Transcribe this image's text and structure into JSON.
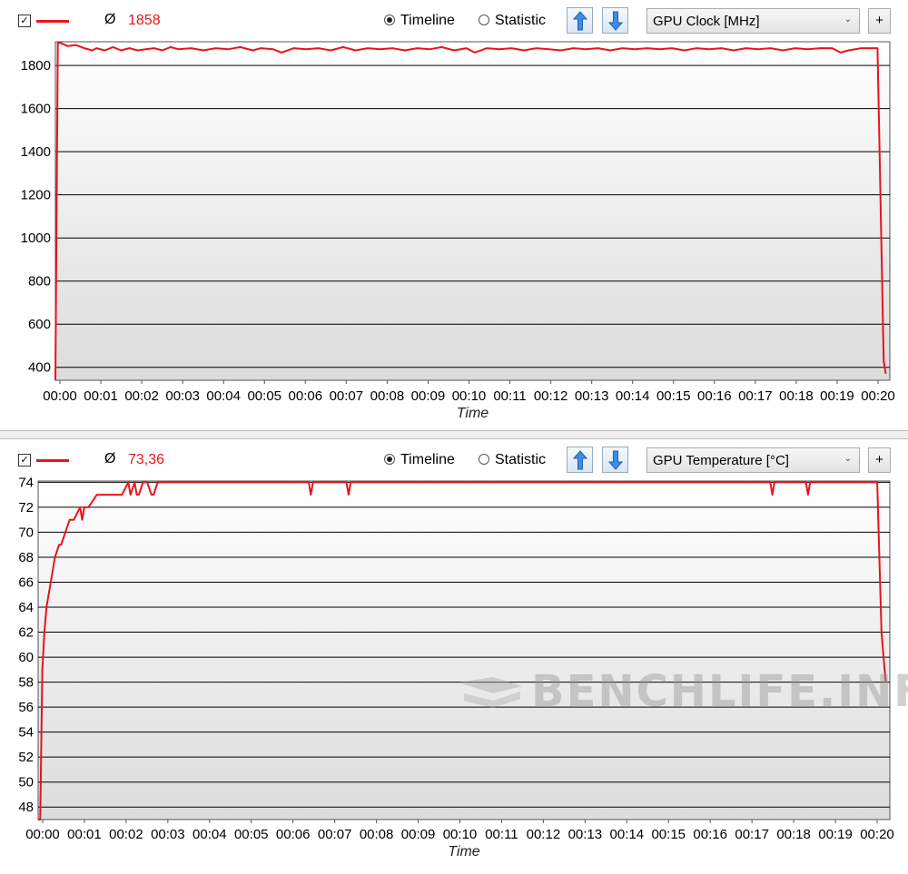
{
  "panels": [
    {
      "checkbox_checked": true,
      "avg_symbol": "Ø",
      "avg_value": "1858",
      "timeline_label": "Timeline",
      "statistic_label": "Statistic",
      "selected_view": "Timeline",
      "sensor_select": "GPU Clock [MHz]",
      "plus_label": "+",
      "line_color": "#e8141c"
    },
    {
      "checkbox_checked": true,
      "avg_symbol": "Ø",
      "avg_value": "73,36",
      "timeline_label": "Timeline",
      "statistic_label": "Statistic",
      "selected_view": "Timeline",
      "sensor_select": "GPU Temperature [°C]",
      "plus_label": "+",
      "line_color": "#e8141c"
    }
  ],
  "watermark": "BENCHLIFE.INFO",
  "chart_data": [
    {
      "type": "line",
      "xlabel": "Time",
      "ylabel": "",
      "x_ticks": [
        "00:00",
        "00:01",
        "00:02",
        "00:03",
        "00:04",
        "00:05",
        "00:06",
        "00:07",
        "00:08",
        "00:09",
        "00:10",
        "00:11",
        "00:12",
        "00:13",
        "00:14",
        "00:15",
        "00:16",
        "00:17",
        "00:18",
        "00:19",
        "00:20"
      ],
      "y_ticks": [
        400,
        600,
        800,
        1000,
        1200,
        1400,
        1600,
        1800
      ],
      "ylim": [
        340,
        1910
      ],
      "xlim_minutes": [
        0,
        20.3
      ],
      "grid": true,
      "series": [
        {
          "x_minutes": [
            0,
            0.06,
            0.12,
            0.3,
            0.5,
            0.7,
            0.9,
            1.0,
            1.2,
            1.4,
            1.6,
            1.8,
            2.0,
            2.2,
            2.4,
            2.6,
            2.8,
            3.0,
            3.3,
            3.6,
            3.9,
            4.2,
            4.5,
            4.8,
            5.0,
            5.3,
            5.5,
            5.8,
            6.1,
            6.4,
            6.7,
            7.0,
            7.3,
            7.6,
            7.9,
            8.2,
            8.5,
            8.8,
            9.1,
            9.4,
            9.7,
            10.0,
            10.2,
            10.5,
            10.8,
            11.1,
            11.4,
            11.7,
            12.0,
            12.3,
            12.6,
            12.9,
            13.2,
            13.5,
            13.8,
            14.1,
            14.4,
            14.7,
            15.0,
            15.3,
            15.6,
            15.9,
            16.2,
            16.5,
            16.8,
            17.1,
            17.4,
            17.7,
            18.0,
            18.3,
            18.6,
            18.9,
            19.1,
            19.3,
            19.6,
            19.9,
            20.0,
            20.05,
            20.15,
            20.2
          ],
          "y": [
            300,
            1905,
            1905,
            1890,
            1895,
            1880,
            1870,
            1880,
            1870,
            1885,
            1870,
            1880,
            1870,
            1875,
            1880,
            1870,
            1885,
            1875,
            1880,
            1870,
            1880,
            1875,
            1885,
            1870,
            1880,
            1875,
            1860,
            1880,
            1875,
            1880,
            1870,
            1885,
            1870,
            1880,
            1875,
            1880,
            1870,
            1880,
            1875,
            1885,
            1870,
            1880,
            1860,
            1880,
            1875,
            1880,
            1870,
            1880,
            1875,
            1870,
            1880,
            1875,
            1880,
            1870,
            1880,
            1875,
            1880,
            1875,
            1880,
            1870,
            1880,
            1875,
            1880,
            1870,
            1880,
            1875,
            1880,
            1870,
            1880,
            1875,
            1880,
            1880,
            1860,
            1870,
            1880,
            1880,
            1880,
            1400,
            430,
            370
          ]
        }
      ]
    },
    {
      "type": "line",
      "xlabel": "Time",
      "ylabel": "",
      "x_ticks": [
        "00:00",
        "00:01",
        "00:02",
        "00:03",
        "00:04",
        "00:05",
        "00:06",
        "00:07",
        "00:08",
        "00:09",
        "00:10",
        "00:11",
        "00:12",
        "00:13",
        "00:14",
        "00:15",
        "00:16",
        "00:17",
        "00:18",
        "00:19",
        "00:20"
      ],
      "y_ticks": [
        48,
        50,
        52,
        54,
        56,
        58,
        60,
        62,
        64,
        66,
        68,
        70,
        72,
        74
      ],
      "ylim": [
        47,
        74.1
      ],
      "xlim_minutes": [
        0,
        20.3
      ],
      "grid": true,
      "series": [
        {
          "x_minutes": [
            0,
            0.05,
            0.1,
            0.15,
            0.2,
            0.3,
            0.4,
            0.5,
            0.55,
            0.65,
            0.75,
            0.85,
            1.0,
            1.05,
            1.1,
            1.2,
            1.4,
            1.5,
            1.8,
            2.0,
            2.15,
            2.2,
            2.3,
            2.35,
            2.4,
            2.5,
            2.6,
            2.7,
            2.75,
            2.85,
            3.0,
            6.45,
            6.5,
            6.55,
            7.35,
            7.4,
            7.45,
            17.45,
            17.5,
            17.55,
            18.3,
            18.35,
            18.4,
            20.0,
            20.1,
            20.2
          ],
          "y": [
            47,
            47,
            59,
            62,
            64,
            66,
            68,
            69,
            69,
            70,
            71,
            71,
            72,
            71,
            72,
            72,
            73,
            73,
            73,
            73,
            74,
            73,
            74,
            73,
            73,
            74,
            74,
            73,
            73,
            74,
            74,
            74,
            73,
            74,
            74,
            73,
            74,
            74,
            73,
            74,
            74,
            73,
            74,
            74,
            62,
            58
          ]
        }
      ]
    }
  ]
}
